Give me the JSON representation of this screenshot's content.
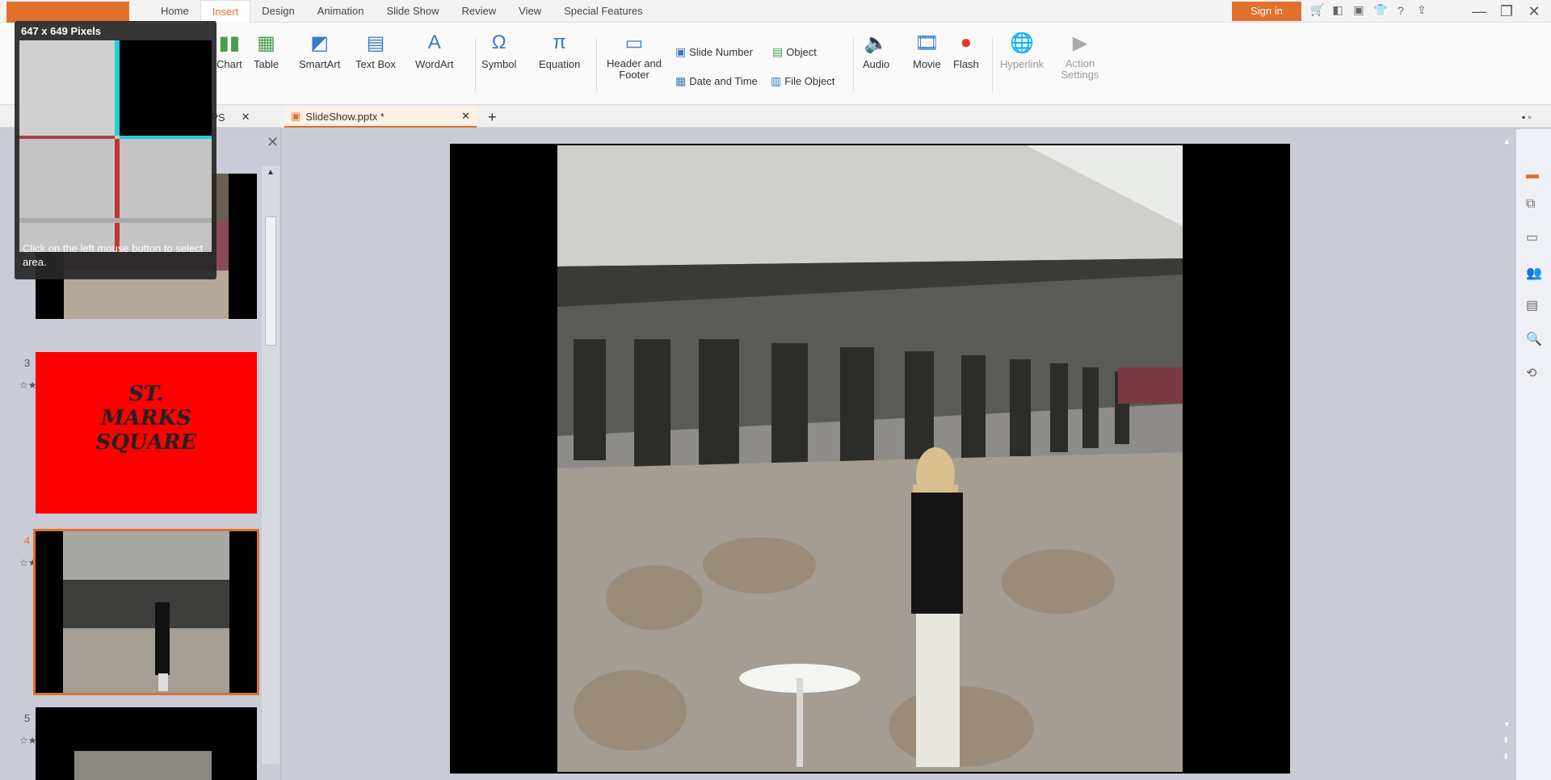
{
  "menubar": {
    "tabs": [
      "Home",
      "Insert",
      "Design",
      "Animation",
      "Slide Show",
      "Review",
      "View",
      "Special Features"
    ],
    "active_tab": "Insert",
    "sign_in": "Sign in",
    "window_controls": [
      "minimize",
      "restore",
      "close"
    ]
  },
  "ribbon": {
    "chart": "Chart",
    "table": "Table",
    "smartart": "SmartArt",
    "text_box": "Text Box",
    "wordart": "WordArt",
    "symbol": "Symbol",
    "equation": "Equation",
    "header_footer": "Header and Footer",
    "slide_number": "Slide Number",
    "object": "Object",
    "date_time": "Date and Time",
    "file_object": "File Object",
    "audio": "Audio",
    "movie": "Movie",
    "flash": "Flash",
    "hyperlink": "Hyperlink",
    "action_settings": "Action Settings"
  },
  "doctabs": {
    "mywps": "My WPS",
    "file": "SlideShow.pptx *"
  },
  "thumbs": {
    "slide3_num": "3",
    "slide3_text": "ST. MARKS SQUARE",
    "slide4_num": "4",
    "slide5_num": "5",
    "star": "☆★"
  },
  "capture": {
    "size": "647 x 649 Pixels",
    "hint": "Click on the left mouse button to select area."
  },
  "colors": {
    "accent": "#e0702a",
    "title_red": "#ff0000"
  }
}
